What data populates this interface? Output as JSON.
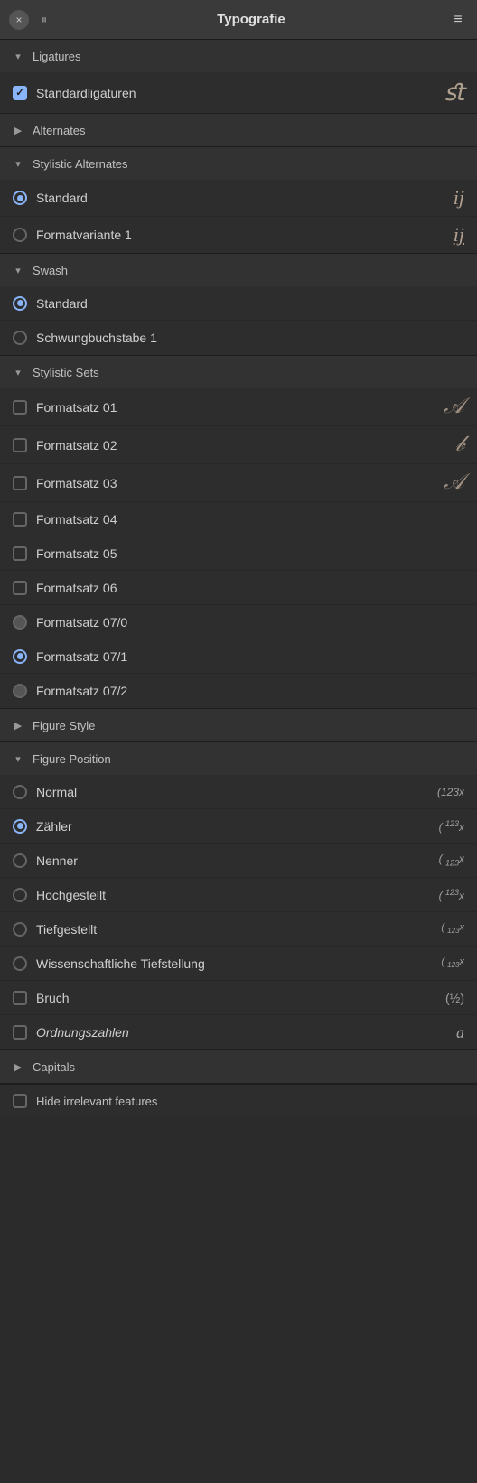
{
  "header": {
    "title": "Typografie",
    "close_label": "×",
    "pause_label": "⏸",
    "menu_label": "≡"
  },
  "sections": {
    "ligatures": {
      "title": "Ligatures",
      "expanded": true,
      "items": [
        {
          "id": "standardligaturen",
          "label": "Standardligaturen",
          "type": "checkbox",
          "checked": true,
          "preview": "ﬆ"
        }
      ]
    },
    "alternates": {
      "title": "Alternates",
      "expanded": false
    },
    "stylistic_alternates": {
      "title": "Stylistic Alternates",
      "expanded": true,
      "items": [
        {
          "id": "sa-standard",
          "label": "Standard",
          "type": "radio",
          "selected": true,
          "preview": "ij"
        },
        {
          "id": "sa-formatvariante1",
          "label": "Formatvariante 1",
          "type": "radio",
          "selected": false,
          "preview": "ij"
        }
      ]
    },
    "swash": {
      "title": "Swash",
      "expanded": true,
      "items": [
        {
          "id": "sw-standard",
          "label": "Standard",
          "type": "radio",
          "selected": true,
          "preview": ""
        },
        {
          "id": "sw-schwung1",
          "label": "Schwungbuchstabe 1",
          "type": "radio",
          "selected": false,
          "preview": ""
        }
      ]
    },
    "stylistic_sets": {
      "title": "Stylistic Sets",
      "expanded": true,
      "items": [
        {
          "id": "fs01",
          "label": "Formatsatz 01",
          "type": "checkbox",
          "checked": false,
          "preview": "𝒜"
        },
        {
          "id": "fs02",
          "label": "Formatsatz 02",
          "type": "checkbox",
          "checked": false,
          "preview": "𝒷"
        },
        {
          "id": "fs03",
          "label": "Formatsatz 03",
          "type": "checkbox",
          "checked": false,
          "preview": "𝒜"
        },
        {
          "id": "fs04",
          "label": "Formatsatz 04",
          "type": "checkbox",
          "checked": false,
          "preview": ""
        },
        {
          "id": "fs05",
          "label": "Formatsatz 05",
          "type": "checkbox",
          "checked": false,
          "preview": ""
        },
        {
          "id": "fs06",
          "label": "Formatsatz 06",
          "type": "checkbox",
          "checked": false,
          "preview": ""
        },
        {
          "id": "fs070",
          "label": "Formatsatz 07/0",
          "type": "radio",
          "selected": false,
          "preview": ""
        },
        {
          "id": "fs071",
          "label": "Formatsatz 07/1",
          "type": "radio",
          "selected": true,
          "preview": ""
        },
        {
          "id": "fs072",
          "label": "Formatsatz 07/2",
          "type": "radio",
          "selected": false,
          "preview": ""
        }
      ]
    },
    "figure_style": {
      "title": "Figure Style",
      "expanded": false
    },
    "figure_position": {
      "title": "Figure Position",
      "expanded": true,
      "items": [
        {
          "id": "fp-normal",
          "label": "Normal",
          "type": "radio",
          "selected": false,
          "preview": "(123x"
        },
        {
          "id": "fp-zahler",
          "label": "Zähler",
          "type": "radio",
          "selected": true,
          "preview": "(¹²³x"
        },
        {
          "id": "fp-nenner",
          "label": "Nenner",
          "type": "radio",
          "selected": false,
          "preview": "(₁₂₃x"
        },
        {
          "id": "fp-hochgestellt",
          "label": "Hochgestellt",
          "type": "radio",
          "selected": false,
          "preview": "(¹²³x"
        },
        {
          "id": "fp-tiefgestellt",
          "label": "Tiefgestellt",
          "type": "radio",
          "selected": false,
          "preview": "(₁₂₃x"
        },
        {
          "id": "fp-wiss",
          "label": "Wissenschaftliche Tiefstellung",
          "type": "radio",
          "selected": false,
          "preview": "(₁₂₃x"
        },
        {
          "id": "fp-bruch",
          "label": "Bruch",
          "type": "checkbox",
          "checked": false,
          "preview": "(½)"
        },
        {
          "id": "fp-ordnung",
          "label": "Ordnungszahlen",
          "type": "checkbox",
          "checked": false,
          "preview": "a",
          "italic": true
        }
      ]
    },
    "capitals": {
      "title": "Capitals",
      "expanded": false
    }
  },
  "bottom": {
    "label": "Hide irrelevant features"
  }
}
